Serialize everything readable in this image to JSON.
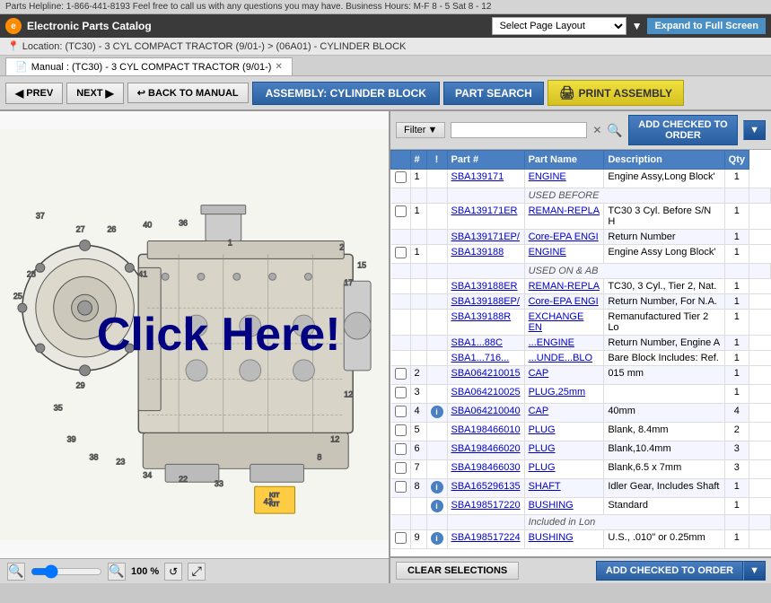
{
  "topbar": {
    "helpline": "Parts Helpline: 1-866-441-8193 Feel free to call us with any questions you may have. Business Hours: M-F 8 - 5 Sat 8 - 12"
  },
  "header": {
    "logo_text": "e",
    "app_title": "Electronic Parts Catalog",
    "layout_placeholder": "Select Page Layout",
    "expand_btn": "Expand to Full Screen"
  },
  "location": {
    "text": "Location: (TC30) - 3 CYL COMPACT TRACTOR (9/01-) > (06A01) - CYLINDER BLOCK"
  },
  "tab": {
    "label": "Manual : (TC30) - 3 CYL COMPACT TRACTOR (9/01-)"
  },
  "toolbar": {
    "prev": "PREV",
    "next": "NEXT",
    "back_to_manual": "BACK TO MANUAL",
    "assembly": "ASSEMBLY: CYLINDER BLOCK",
    "part_search": "PART SEARCH",
    "print": "PRINT ASSEMBLY"
  },
  "filter": {
    "label": "Filter",
    "placeholder": "",
    "add_order": "ADD CHECKED TO ORDER"
  },
  "table": {
    "headers": [
      "",
      "#",
      "!",
      "Part #",
      "Part Name",
      "Description",
      "Qty"
    ],
    "rows": [
      {
        "cb": "",
        "num": "1",
        "info": "",
        "part": "SBA139171",
        "name": "ENGINE",
        "desc": "Engine Assy,Long Block'",
        "qty": "1"
      },
      {
        "cb": "",
        "num": "",
        "info": "",
        "part": "",
        "name": "USED BEFORE",
        "desc": "",
        "qty": ""
      },
      {
        "cb": "",
        "num": "1",
        "info": "",
        "part": "SBA139171ER",
        "name": "REMAN-REPLA",
        "desc": "TC30 3 Cyl. Before S/N H",
        "qty": "1"
      },
      {
        "cb": "",
        "num": "",
        "info": "",
        "part": "SBA139171EP/",
        "name": "Core-EPA ENGI",
        "desc": "Return Number",
        "qty": "1"
      },
      {
        "cb": "",
        "num": "1",
        "info": "",
        "part": "SBA139188",
        "name": "ENGINE",
        "desc": "Engine Assy Long Block'",
        "qty": "1"
      },
      {
        "cb": "",
        "num": "",
        "info": "",
        "part": "",
        "name": "USED ON & AB",
        "desc": "",
        "qty": ""
      },
      {
        "cb": "",
        "num": "",
        "info": "",
        "part": "SBA139188ER",
        "name": "REMAN-REPLA",
        "desc": "TC30, 3 Cyl., Tier 2, Nat.",
        "qty": "1"
      },
      {
        "cb": "",
        "num": "",
        "info": "",
        "part": "SBA139188EP/",
        "name": "Core-EPA ENGI",
        "desc": "Return Number, For N.A.",
        "qty": "1"
      },
      {
        "cb": "",
        "num": "",
        "info": "",
        "part": "SBA139188R",
        "name": "EXCHANGE EN",
        "desc": "Remanufactured Tier 2 Lo",
        "qty": "1"
      },
      {
        "cb": "",
        "num": "",
        "info": "",
        "part": "SBA1...88C",
        "name": "...ENGINE",
        "desc": "Return Number, Engine A",
        "qty": "1"
      },
      {
        "cb": "",
        "num": "",
        "info": "",
        "part": "SBA1...716...",
        "name": "...UNDE...BLO",
        "desc": "Bare Block Includes: Ref.",
        "qty": "1"
      },
      {
        "cb": "",
        "num": "2",
        "info": "",
        "part": "SBA064210015",
        "name": "CAP",
        "desc": "015 mm",
        "qty": "1"
      },
      {
        "cb": "",
        "num": "3",
        "info": "",
        "part": "SBA064210025",
        "name": "PLUG,25mm",
        "desc": "",
        "qty": "1"
      },
      {
        "cb": "",
        "num": "4",
        "info": "i",
        "part": "SBA064210040",
        "name": "CAP",
        "desc": "40mm",
        "qty": "4"
      },
      {
        "cb": "",
        "num": "5",
        "info": "",
        "part": "SBA198466010",
        "name": "PLUG",
        "desc": "Blank, 8.4mm",
        "qty": "2"
      },
      {
        "cb": "",
        "num": "6",
        "info": "",
        "part": "SBA198466020",
        "name": "PLUG",
        "desc": "Blank,10.4mm",
        "qty": "3"
      },
      {
        "cb": "",
        "num": "7",
        "info": "",
        "part": "SBA198466030",
        "name": "PLUG",
        "desc": "Blank,6.5 x 7mm",
        "qty": "3"
      },
      {
        "cb": "",
        "num": "8",
        "info": "i",
        "part": "SBA165296135",
        "name": "SHAFT",
        "desc": "Idler Gear, Includes Shaft",
        "qty": "1"
      },
      {
        "cb": "",
        "num": "",
        "info": "i",
        "part": "SBA198517220",
        "name": "BUSHING",
        "desc": "Standard",
        "qty": "1"
      },
      {
        "cb": "",
        "num": "",
        "info": "",
        "part": "",
        "name": "Included in Lon",
        "desc": "",
        "qty": ""
      },
      {
        "cb": "",
        "num": "9",
        "info": "i",
        "part": "SBA198517224",
        "name": "BUSHING",
        "desc": "U.S., .010\" or 0.25mm",
        "qty": "1"
      }
    ]
  },
  "bottom": {
    "clear": "CLEAR SELECTIONS",
    "add_order": "ADD CHECKED TO ORDER"
  },
  "zoom": {
    "level": "100 %"
  },
  "click_overlay": "Click Here!"
}
